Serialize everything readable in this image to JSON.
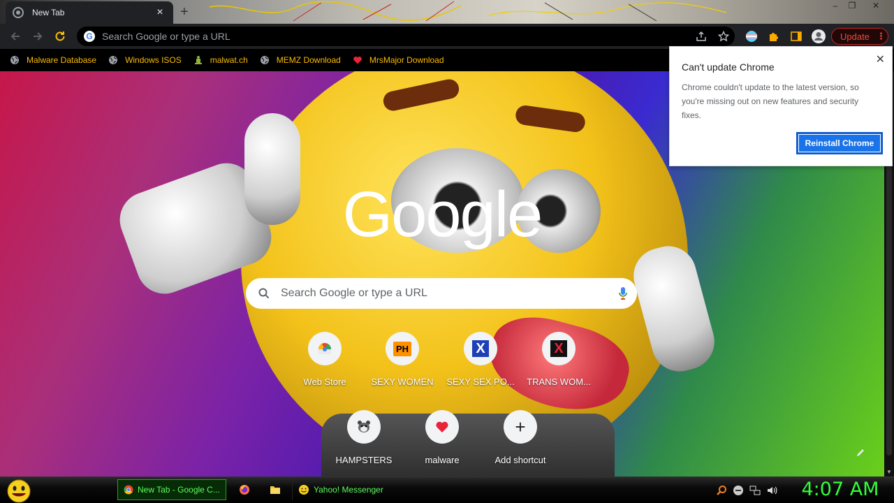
{
  "browser": {
    "tab_title": "New Tab",
    "tab_close": "×",
    "new_tab": "+",
    "window_controls": [
      "–",
      "❐",
      "✕"
    ],
    "omnibox_placeholder": "Search Google or type a URL",
    "update_label": "Update",
    "update_menu": "⋮"
  },
  "bookmarks": [
    {
      "label": "Malware Database",
      "icon": "globe-icon"
    },
    {
      "label": "Windows ISOS",
      "icon": "globe-icon"
    },
    {
      "label": "malwat.ch",
      "icon": "figure-icon"
    },
    {
      "label": "MEMZ Download",
      "icon": "globe-icon"
    },
    {
      "label": "MrsMajor Download",
      "icon": "heart-icon"
    }
  ],
  "popup": {
    "title": "Can't update Chrome",
    "close": "✕",
    "body": "Chrome couldn't update to the latest version, so you're missing out on new features and security fixes.",
    "button": "Reinstall Chrome"
  },
  "ntp": {
    "logo": "Google",
    "search_placeholder": "Search Google or type a URL",
    "shortcuts": [
      {
        "label": "Web Store",
        "icon": "webstore-icon"
      },
      {
        "label": "SEXY WOMEN",
        "icon": "ph-icon"
      },
      {
        "label": "SEXY SEX PO...",
        "icon": "x-blue-icon"
      },
      {
        "label": "TRANS WOM...",
        "icon": "x-red-icon"
      },
      {
        "label": "HAMPSTERS",
        "icon": "hamster-icon"
      },
      {
        "label": "malware",
        "icon": "heart-icon"
      },
      {
        "label": "Add shortcut",
        "icon": "plus-icon"
      }
    ],
    "ph_text": "PH",
    "x_text": "X",
    "plus_text": "+"
  },
  "taskbar": {
    "tasks": [
      {
        "label": "New Tab - Google C...",
        "icon": "chrome-icon",
        "active": true
      },
      {
        "label": "",
        "icon": "firefox-icon",
        "active": false
      },
      {
        "label": "",
        "icon": "folder-icon",
        "active": false
      },
      {
        "label": "Yahoo! Messenger",
        "icon": "smiley-icon",
        "active": false
      }
    ],
    "clock": "4:07 AM"
  },
  "colors": {
    "accent_blue": "#1a73e8",
    "update_red": "#f04a3e",
    "bookmark_text": "#fbbc04",
    "taskbar_green": "#32ff3a"
  }
}
